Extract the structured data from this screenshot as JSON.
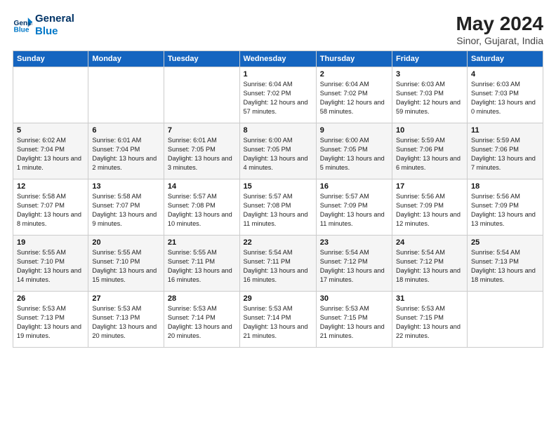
{
  "header": {
    "logo_line1": "General",
    "logo_line2": "Blue",
    "month": "May 2024",
    "location": "Sinor, Gujarat, India"
  },
  "weekdays": [
    "Sunday",
    "Monday",
    "Tuesday",
    "Wednesday",
    "Thursday",
    "Friday",
    "Saturday"
  ],
  "weeks": [
    [
      {
        "day": "",
        "info": ""
      },
      {
        "day": "",
        "info": ""
      },
      {
        "day": "",
        "info": ""
      },
      {
        "day": "1",
        "info": "Sunrise: 6:04 AM\nSunset: 7:02 PM\nDaylight: 12 hours and 57 minutes."
      },
      {
        "day": "2",
        "info": "Sunrise: 6:04 AM\nSunset: 7:02 PM\nDaylight: 12 hours and 58 minutes."
      },
      {
        "day": "3",
        "info": "Sunrise: 6:03 AM\nSunset: 7:03 PM\nDaylight: 12 hours and 59 minutes."
      },
      {
        "day": "4",
        "info": "Sunrise: 6:03 AM\nSunset: 7:03 PM\nDaylight: 13 hours and 0 minutes."
      }
    ],
    [
      {
        "day": "5",
        "info": "Sunrise: 6:02 AM\nSunset: 7:04 PM\nDaylight: 13 hours and 1 minute."
      },
      {
        "day": "6",
        "info": "Sunrise: 6:01 AM\nSunset: 7:04 PM\nDaylight: 13 hours and 2 minutes."
      },
      {
        "day": "7",
        "info": "Sunrise: 6:01 AM\nSunset: 7:05 PM\nDaylight: 13 hours and 3 minutes."
      },
      {
        "day": "8",
        "info": "Sunrise: 6:00 AM\nSunset: 7:05 PM\nDaylight: 13 hours and 4 minutes."
      },
      {
        "day": "9",
        "info": "Sunrise: 6:00 AM\nSunset: 7:05 PM\nDaylight: 13 hours and 5 minutes."
      },
      {
        "day": "10",
        "info": "Sunrise: 5:59 AM\nSunset: 7:06 PM\nDaylight: 13 hours and 6 minutes."
      },
      {
        "day": "11",
        "info": "Sunrise: 5:59 AM\nSunset: 7:06 PM\nDaylight: 13 hours and 7 minutes."
      }
    ],
    [
      {
        "day": "12",
        "info": "Sunrise: 5:58 AM\nSunset: 7:07 PM\nDaylight: 13 hours and 8 minutes."
      },
      {
        "day": "13",
        "info": "Sunrise: 5:58 AM\nSunset: 7:07 PM\nDaylight: 13 hours and 9 minutes."
      },
      {
        "day": "14",
        "info": "Sunrise: 5:57 AM\nSunset: 7:08 PM\nDaylight: 13 hours and 10 minutes."
      },
      {
        "day": "15",
        "info": "Sunrise: 5:57 AM\nSunset: 7:08 PM\nDaylight: 13 hours and 11 minutes."
      },
      {
        "day": "16",
        "info": "Sunrise: 5:57 AM\nSunset: 7:09 PM\nDaylight: 13 hours and 11 minutes."
      },
      {
        "day": "17",
        "info": "Sunrise: 5:56 AM\nSunset: 7:09 PM\nDaylight: 13 hours and 12 minutes."
      },
      {
        "day": "18",
        "info": "Sunrise: 5:56 AM\nSunset: 7:09 PM\nDaylight: 13 hours and 13 minutes."
      }
    ],
    [
      {
        "day": "19",
        "info": "Sunrise: 5:55 AM\nSunset: 7:10 PM\nDaylight: 13 hours and 14 minutes."
      },
      {
        "day": "20",
        "info": "Sunrise: 5:55 AM\nSunset: 7:10 PM\nDaylight: 13 hours and 15 minutes."
      },
      {
        "day": "21",
        "info": "Sunrise: 5:55 AM\nSunset: 7:11 PM\nDaylight: 13 hours and 16 minutes."
      },
      {
        "day": "22",
        "info": "Sunrise: 5:54 AM\nSunset: 7:11 PM\nDaylight: 13 hours and 16 minutes."
      },
      {
        "day": "23",
        "info": "Sunrise: 5:54 AM\nSunset: 7:12 PM\nDaylight: 13 hours and 17 minutes."
      },
      {
        "day": "24",
        "info": "Sunrise: 5:54 AM\nSunset: 7:12 PM\nDaylight: 13 hours and 18 minutes."
      },
      {
        "day": "25",
        "info": "Sunrise: 5:54 AM\nSunset: 7:13 PM\nDaylight: 13 hours and 18 minutes."
      }
    ],
    [
      {
        "day": "26",
        "info": "Sunrise: 5:53 AM\nSunset: 7:13 PM\nDaylight: 13 hours and 19 minutes."
      },
      {
        "day": "27",
        "info": "Sunrise: 5:53 AM\nSunset: 7:13 PM\nDaylight: 13 hours and 20 minutes."
      },
      {
        "day": "28",
        "info": "Sunrise: 5:53 AM\nSunset: 7:14 PM\nDaylight: 13 hours and 20 minutes."
      },
      {
        "day": "29",
        "info": "Sunrise: 5:53 AM\nSunset: 7:14 PM\nDaylight: 13 hours and 21 minutes."
      },
      {
        "day": "30",
        "info": "Sunrise: 5:53 AM\nSunset: 7:15 PM\nDaylight: 13 hours and 21 minutes."
      },
      {
        "day": "31",
        "info": "Sunrise: 5:53 AM\nSunset: 7:15 PM\nDaylight: 13 hours and 22 minutes."
      },
      {
        "day": "",
        "info": ""
      }
    ]
  ]
}
